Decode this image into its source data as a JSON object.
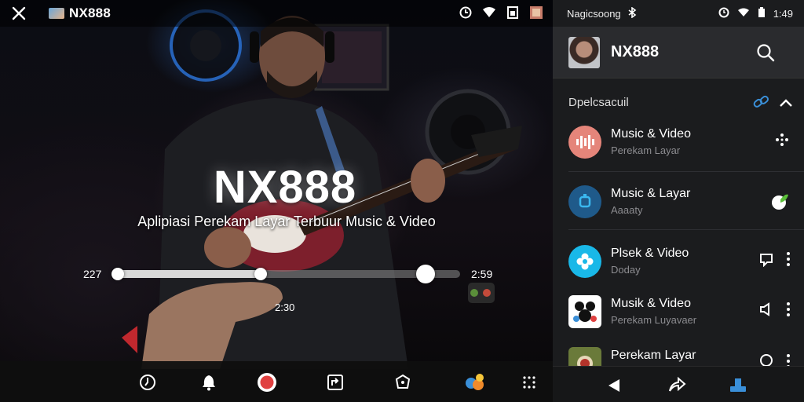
{
  "player": {
    "app_name": "NX888",
    "title": "NX888",
    "subtitle": "Aplipiasi Perekam Layar Terbuur Music & Video",
    "time_left": "227",
    "time_right": "2:59",
    "time_mid": "2:30",
    "progress": 0.42,
    "buffer_handle": 0.9
  },
  "panel": {
    "status_text": "Nagicsoong",
    "clock": "1:49",
    "title": "NX888",
    "section_label": "Dpelcsacuil",
    "items": [
      {
        "title": "Music & Video",
        "subtitle": "Perekam Layar",
        "icon": "audio-waveform-icon",
        "color": "#e5857a"
      },
      {
        "title": "Music & Layar",
        "subtitle": "Aaaaty",
        "icon": "record-app-icon",
        "color": "#1f5a8a"
      },
      {
        "title": "Plsek & Video",
        "subtitle": "Doday",
        "icon": "flower-app-icon",
        "color": "#19b8e8"
      },
      {
        "title": "Musik & Video",
        "subtitle": "Perekam Luyavaer",
        "icon": "panda-app-icon",
        "color": "#ffffff"
      },
      {
        "title": "Perekam Layar",
        "subtitle": "",
        "icon": "badge-app-icon",
        "color": "#6a7a3a"
      }
    ]
  },
  "colors": {
    "accent_blue": "#3a8fd8",
    "record_red": "#e04040",
    "panel_bg": "#1b1c1e"
  }
}
